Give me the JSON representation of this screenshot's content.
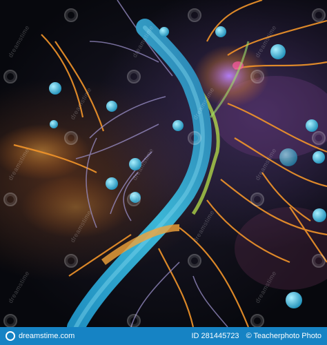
{
  "watermark": {
    "text": "dreamstime",
    "brand": "dreamstime.com"
  },
  "footer": {
    "site": "dreamstime.com",
    "image_id": "ID 281445723",
    "credit": "© Teacherphoto Photo"
  },
  "colors": {
    "footer_bg": "#1683c4",
    "axon": "#2aa3c9",
    "orange": "#f29a2e",
    "purple": "#8a5bd6"
  }
}
